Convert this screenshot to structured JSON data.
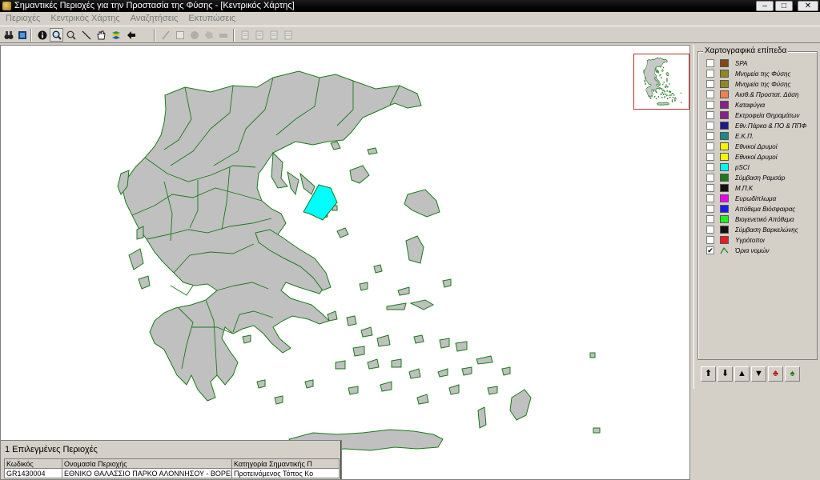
{
  "window": {
    "title": "Σημαντικές Περιοχές για την Προστασία της Φύσης - [Κεντρικός Χάρτης]",
    "controls": {
      "minimize": "–",
      "maximize": "□",
      "close": "✕"
    }
  },
  "menu": [
    "Περιοχές",
    "Κεντρικός Χάρτης",
    "Αναζητήσεις",
    "Εκτυπώσεις"
  ],
  "toolbar": [
    {
      "name": "binoculars-search-icon",
      "glyph": "binoculars"
    },
    {
      "name": "layers-panel-icon",
      "glyph": "layers"
    },
    {
      "name": "info-icon",
      "glyph": "info"
    },
    {
      "name": "zoom-in-icon",
      "glyph": "zoom",
      "active": true
    },
    {
      "name": "zoom-out-icon",
      "glyph": "zoomout"
    },
    {
      "name": "measure-line-icon",
      "glyph": "line"
    },
    {
      "name": "pan-hand-icon",
      "glyph": "hand"
    },
    {
      "name": "layer-stack-icon",
      "glyph": "stack"
    },
    {
      "name": "back-arrow-icon",
      "glyph": "back"
    },
    {
      "name": "draw-line-icon",
      "glyph": "pen",
      "disabled": true
    },
    {
      "name": "rectangle-select-icon",
      "glyph": "rect",
      "disabled": true
    },
    {
      "name": "circle-select-icon",
      "glyph": "circle",
      "disabled": true
    },
    {
      "name": "polygon-select-icon",
      "glyph": "poly",
      "disabled": true
    },
    {
      "name": "eraser-icon",
      "glyph": "erase",
      "disabled": true
    },
    {
      "name": "report-icon",
      "glyph": "doc",
      "disabled": true
    },
    {
      "name": "clipboard-icon",
      "glyph": "doc",
      "disabled": true
    },
    {
      "name": "export-icon",
      "glyph": "doc",
      "disabled": true
    },
    {
      "name": "print-preview-icon",
      "glyph": "doc",
      "disabled": true
    }
  ],
  "layers_panel": {
    "title": "Χαρτογραφικά επίπεδα",
    "items": [
      {
        "label": "SPA",
        "color": "#8b4513",
        "checked": false
      },
      {
        "label": "Μνημεία της Φύσης",
        "color": "#8f8a1f",
        "checked": false
      },
      {
        "label": "Μνημεία της Φύσης",
        "color": "#8f8a1f",
        "checked": false
      },
      {
        "label": "Αισθ.& Προστατ. Δάση",
        "color": "#f08050",
        "checked": false
      },
      {
        "label": "Καταφύγια",
        "color": "#8a1f8a",
        "checked": false
      },
      {
        "label": "Εκτροφεία Θηραμάτων",
        "color": "#8a1f8a",
        "checked": false
      },
      {
        "label": "Εθν.Πάρκα & ΠΟ & ΠΠΦ",
        "color": "#1a1a8a",
        "checked": false
      },
      {
        "label": "Ε.Κ.Π.",
        "color": "#1a8a8a",
        "checked": false
      },
      {
        "label": "Εθνικοί Δρυμοί",
        "color": "#f5f500",
        "checked": false
      },
      {
        "label": "Εθνικοί Δρυμοί",
        "color": "#f5f500",
        "checked": false
      },
      {
        "label": "pSCI",
        "color": "#00f5f5",
        "checked": false
      },
      {
        "label": "Σύμβαση Ραμσάρ",
        "color": "#1a7a1a",
        "checked": false
      },
      {
        "label": "Μ.Π.Κ",
        "color": "#111111",
        "checked": false
      },
      {
        "label": "Ευρωδίπλωμα",
        "color": "#f000f0",
        "checked": false
      },
      {
        "label": "Απόθεμα Βιόσφαιρας",
        "color": "#1a1af0",
        "checked": false
      },
      {
        "label": "Βιογενετικό Απόθεμα",
        "color": "#20f020",
        "checked": false
      },
      {
        "label": "Σύμβαση Βαρκελώνης",
        "color": "#111111",
        "checked": false
      },
      {
        "label": "Υγρότοποι",
        "color": "#f01a1a",
        "checked": false
      },
      {
        "label": "Όρια νομών",
        "color": "#1a7a1a",
        "checked": true,
        "line": true
      }
    ],
    "tools": [
      {
        "name": "move-up-icon",
        "glyph": "⬆"
      },
      {
        "name": "move-down-icon",
        "glyph": "⬇"
      },
      {
        "name": "move-top-icon",
        "glyph": "▲"
      },
      {
        "name": "move-bottom-icon",
        "glyph": "▼"
      },
      {
        "name": "show-layer-icon",
        "glyph": "♣"
      },
      {
        "name": "hide-layer-icon",
        "glyph": "♠"
      }
    ]
  },
  "selected_areas": {
    "title": "1 Επιλεγμένες Περιοχές",
    "columns": [
      "Κωδικός",
      "Ονομασία Περιοχής",
      "Κατηγορία Σημαντικής Π"
    ],
    "rows": [
      [
        "GR1430004",
        "ΕΘΝΙΚΟ ΘΑΛΑΣΣΙΟ ΠΑΡΚΟ ΑΛΟΝΝΗΣΟΥ - ΒΟΡΕΙΩΝ ΣΠ",
        "Προτεινόμενος Τόπος Κο"
      ]
    ]
  },
  "colors": {
    "map_fill": "#c0c0c0",
    "boundary": "#1a7a1a",
    "selection": "#00ffff"
  }
}
